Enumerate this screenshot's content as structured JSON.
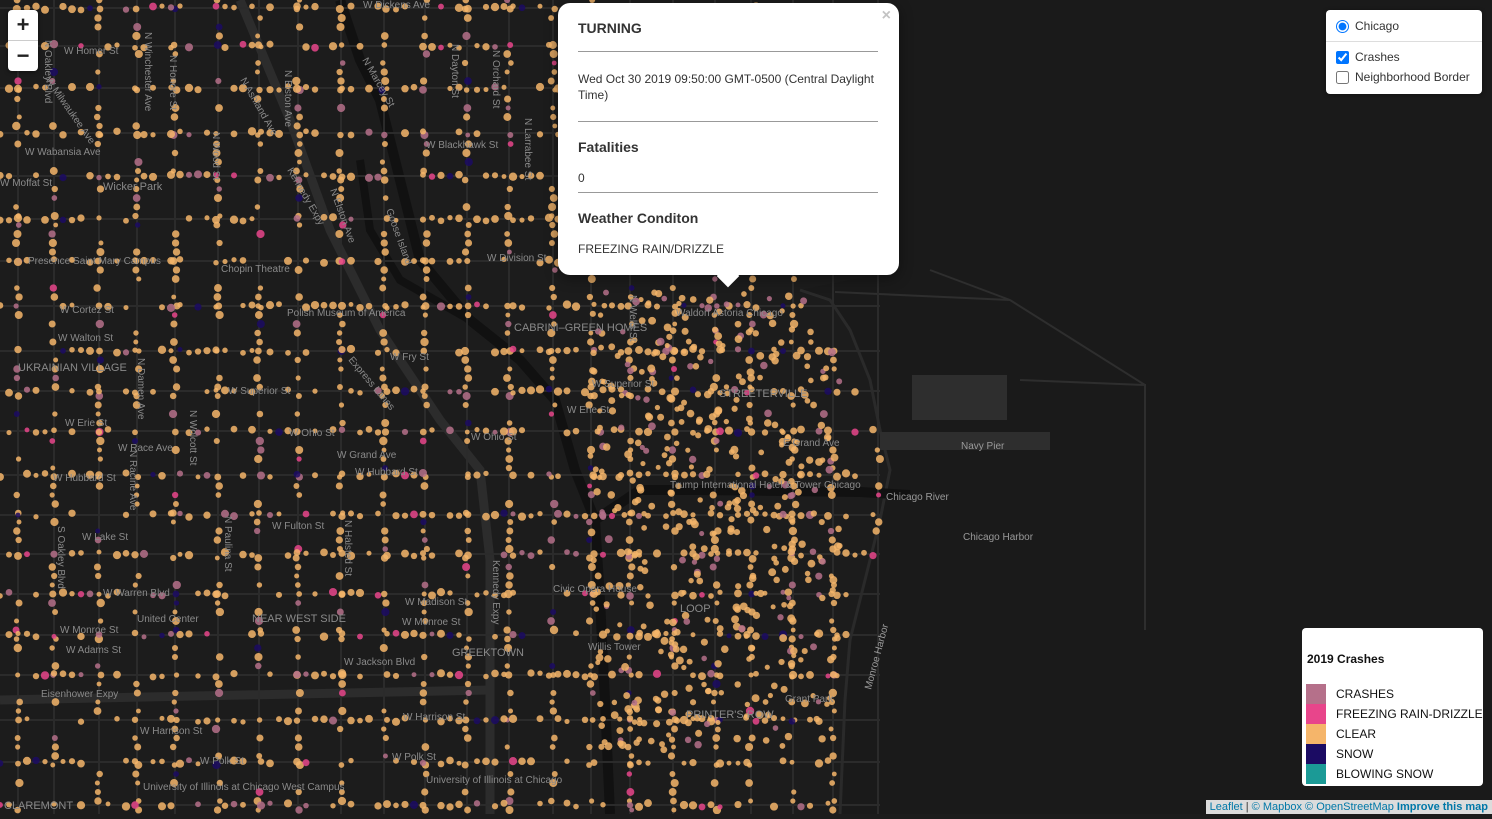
{
  "zoom": {
    "in_label": "+",
    "out_label": "−"
  },
  "popup": {
    "title": "TURNING",
    "datetime": "Wed Oct 30 2019 09:50:00 GMT-0500 (Central Daylight Time)",
    "fatalities_heading": "Fatalities",
    "fatalities_value": "0",
    "weather_heading": "Weather Conditon",
    "weather_value": "FREEZING RAIN/DRIZZLE",
    "close": "×"
  },
  "layers": {
    "base": "Chicago",
    "overlays": [
      {
        "label": "Crashes",
        "checked": true
      },
      {
        "label": "Neighborhood Border",
        "checked": false
      }
    ]
  },
  "legend": {
    "title": "2019 Crashes",
    "items": [
      {
        "label": "CRASHES",
        "color": "#b5708a"
      },
      {
        "label": "FREEZING RAIN-DRIZZLE",
        "color": "#e8458b"
      },
      {
        "label": "CLEAR",
        "color": "#f5b56a"
      },
      {
        "label": "SNOW",
        "color": "#1b0b63"
      },
      {
        "label": "BLOWING SNOW",
        "color": "#1b9a96"
      }
    ]
  },
  "attribution": {
    "leaflet": "Leaflet",
    "mapbox": "© Mapbox",
    "osm": "© OpenStreetMap",
    "improve": "Improve this map"
  },
  "map_labels": [
    "W Dickens Ave",
    "W Homer St",
    "N Oakley Blvd",
    "N Winchester Ave",
    "N Honore St",
    "N Ashland Ave",
    "N Elston Ave",
    "N Marcey St",
    "N Dayton St",
    "N Orchard St",
    "N Larrabee St",
    "W Blackhawk St",
    "W Milwaukee Ave",
    "Wicker Park",
    "W Wabansia Ave",
    "W Moffat St",
    "Kennedy Expy",
    "N Elston Ave",
    "Goose Island",
    "N Wood St",
    "Presence Saint Mary Campus",
    "Chopin Theatre",
    "W Division St",
    "W Cortez St",
    "Polish Museum of America",
    "CABRINI–GREEN HOMES",
    "N Wells St",
    "Waldorf Astoria Chicago",
    "W Walton St",
    "UKRAINIAN VILLAGE",
    "W Fry St",
    "W Superior St",
    "W Superior St",
    "W Erie St",
    "W Erie St",
    "Express Lanes",
    "W Ohio St",
    "W Ohio St",
    "STREETERVILLE",
    "W Race Ave",
    "W Grand Ave",
    "W Hubbard St",
    "E Grand Ave",
    "Navy Pier",
    "W Hubbard St",
    "Trump International Hotel & Tower Chicago",
    "Chicago River",
    "W Fulton St",
    "N Paulina St",
    "W Lake St",
    "Chicago Harbor",
    "W Warren Blvd",
    "United Center",
    "NEAR WEST SIDE",
    "W Madison St",
    "Civic Opera House",
    "LOOP",
    "W Monroe St",
    "W Monroe St",
    "W Adams St",
    "Willis Tower",
    "GREEKTOWN",
    "W Jackson Blvd",
    "Eisenhower Expy",
    "Monroe Harbor",
    "Grant Park",
    "W Harrison St",
    "W Harrison St",
    "PRINTER'S ROW",
    "W Polk St",
    "W Polk St",
    "University of Illinois at Chicago West Campus",
    "University of Illinois at Chicago",
    "CLAREMONT",
    "N Damen Ave",
    "N Wolcott St",
    "S Oakley Blvd",
    "N Racine Ave",
    "Kennedy Expy",
    "N Halsted St"
  ]
}
